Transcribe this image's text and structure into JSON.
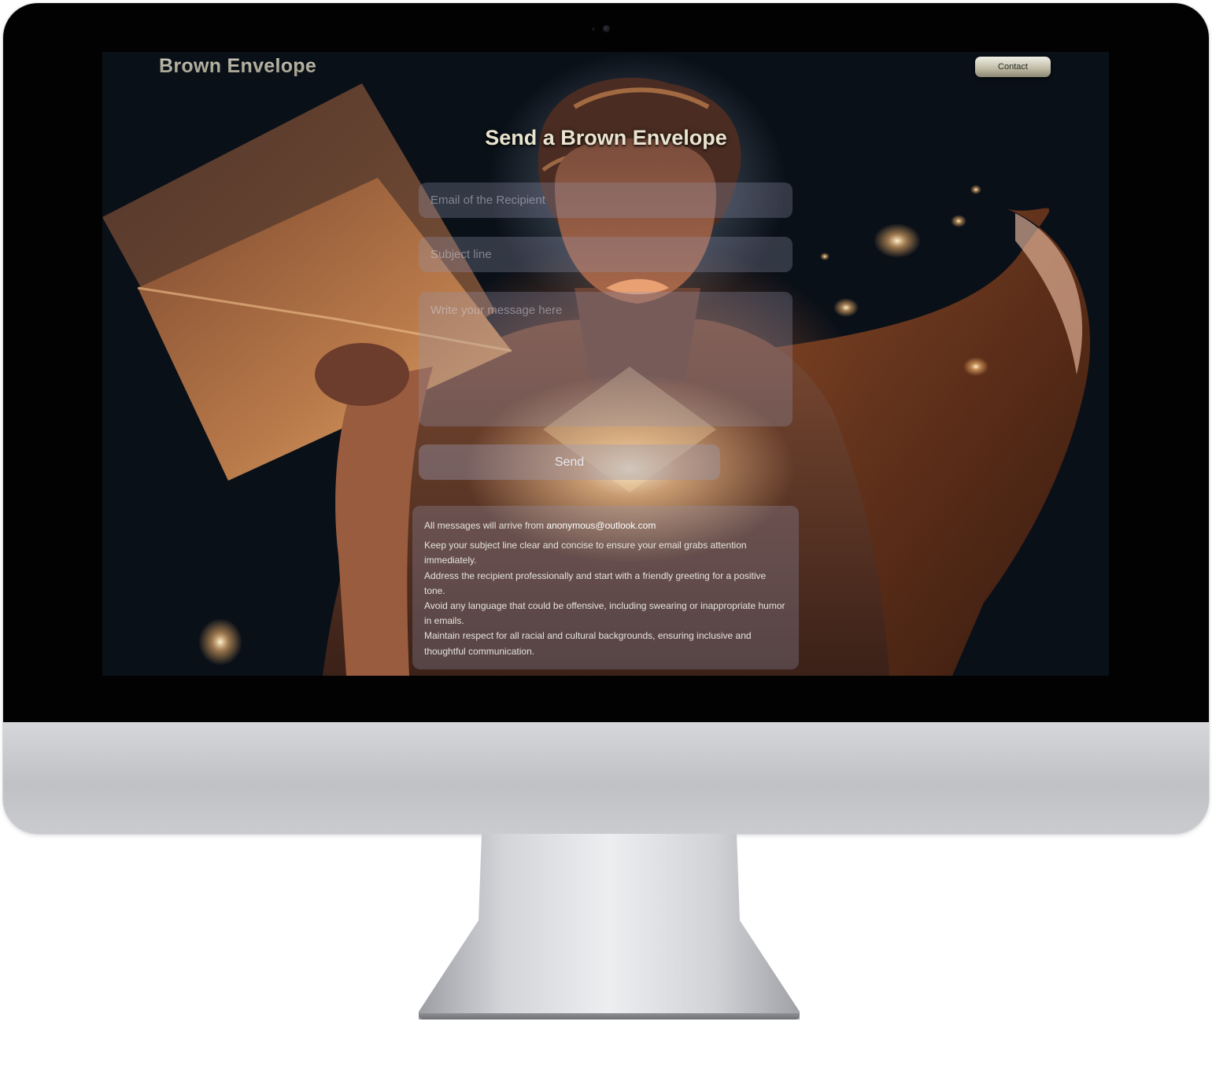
{
  "brand": {
    "name": "Brown Envelope"
  },
  "nav": {
    "contact_label": "Contact"
  },
  "form": {
    "title": "Send a Brown Envelope",
    "email_placeholder": "Email of the Recipient",
    "subject_placeholder": "Subject line",
    "message_placeholder": "Write your message here",
    "send_label": "Send"
  },
  "info": {
    "sender_prefix": "All messages will arrive from",
    "sender_email": "anonymous@outlook.com",
    "guidelines": [
      "Keep your subject line clear and concise to ensure your email grabs attention immediately.",
      "Address the recipient professionally and start with a friendly greeting for a positive tone.",
      "Avoid any language that could be offensive, including swearing or inappropriate humor in emails.",
      "Maintain respect for all racial and cultural backgrounds, ensuring inclusive and thoughtful communication."
    ]
  },
  "colors": {
    "bezel": "#020202",
    "chin": "#c5c7cb",
    "page_background": "#0a1018",
    "accent_glow": "#f6c590",
    "cape_brown": "#7a4326",
    "contact_button": "#bdb9a2",
    "title_text": "#e9e4cf"
  }
}
